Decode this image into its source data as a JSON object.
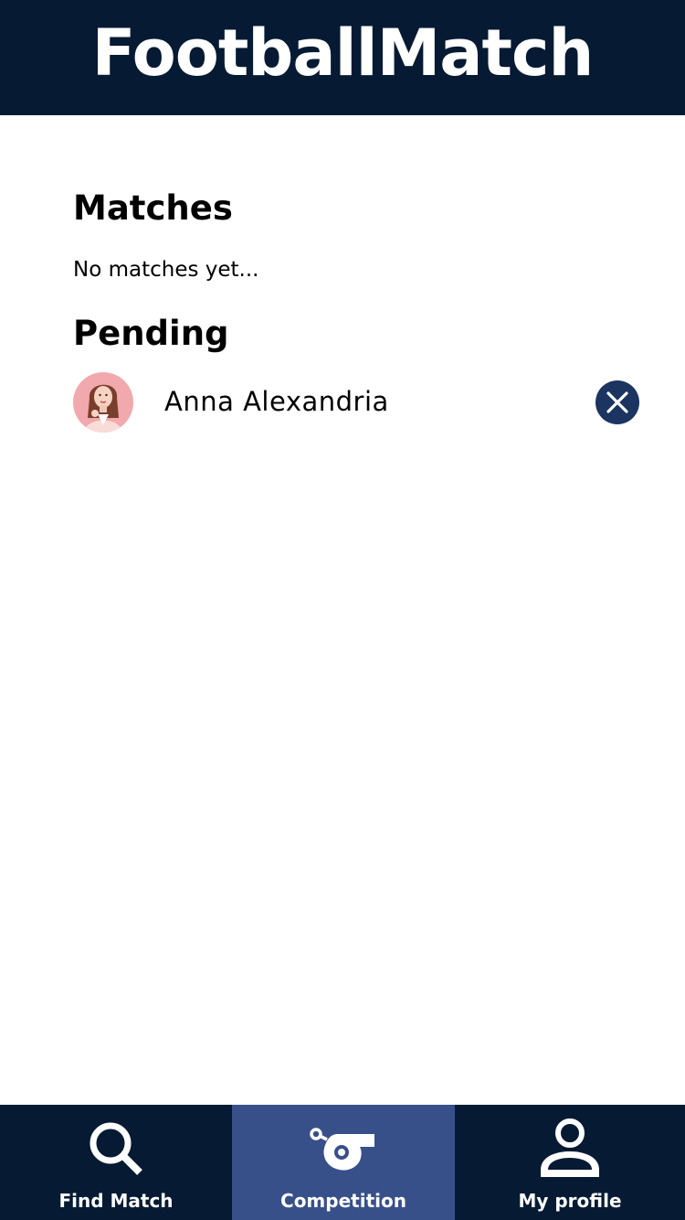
{
  "app": {
    "title": "FootballMatch",
    "colors": {
      "header_bg": "#061a33",
      "nav_active_bg": "#385089",
      "remove_button_bg": "#1b3460"
    }
  },
  "matches": {
    "heading": "Matches",
    "empty_text": "No matches yet..."
  },
  "pending": {
    "heading": "Pending",
    "items": [
      {
        "name": "Anna Alexandria",
        "avatar_icon": "avatar-photo",
        "action_icon": "close-icon"
      }
    ]
  },
  "nav": {
    "items": [
      {
        "label": "Find Match",
        "icon": "search-icon",
        "active": false
      },
      {
        "label": "Competition",
        "icon": "whistle-icon",
        "active": true
      },
      {
        "label": "My profile",
        "icon": "user-icon",
        "active": false
      }
    ]
  }
}
